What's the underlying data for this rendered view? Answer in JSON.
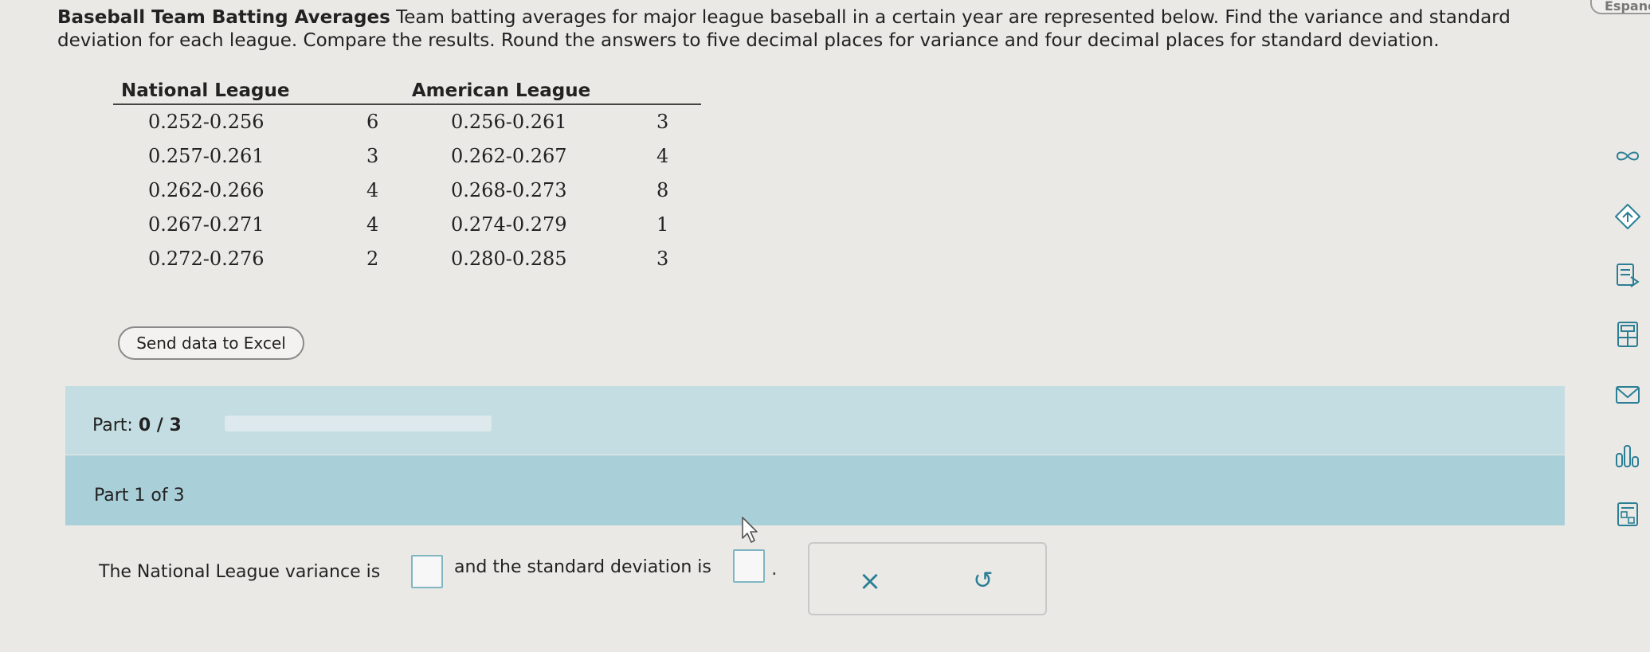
{
  "problem": {
    "title": "Baseball Team Batting Averages",
    "text": " Team batting averages for major league baseball in a certain year are represented below. Find the variance and standard deviation for each league. Compare the results. Round the answers to five decimal places for variance and four decimal places for standard deviation."
  },
  "table": {
    "headers": [
      "National League",
      "",
      "American League",
      ""
    ],
    "rows": [
      [
        "0.252-0.256",
        "6",
        "0.256-0.261",
        "3"
      ],
      [
        "0.257-0.261",
        "3",
        "0.262-0.267",
        "4"
      ],
      [
        "0.262-0.266",
        "4",
        "0.268-0.273",
        "8"
      ],
      [
        "0.267-0.271",
        "4",
        "0.274-0.279",
        "1"
      ],
      [
        "0.272-0.276",
        "2",
        "0.280-0.285",
        "3"
      ]
    ]
  },
  "excel_button": "Send data to Excel",
  "part": {
    "label": "Part:",
    "value": "0 / 3",
    "progress": 0
  },
  "subpart": {
    "label": "Part 1 of 3"
  },
  "question": {
    "before": "The National League variance is",
    "middle": "and the standard deviation is",
    "end": "."
  },
  "actions": {
    "clear_glyph": "×",
    "undo_glyph": "↺"
  },
  "sidebar": {
    "language": "Espanol",
    "icons": [
      "infinity-icon",
      "hint-icon",
      "ebook-icon",
      "calculator-icon",
      "mail-icon",
      "statistics-icon",
      "formula-icon"
    ]
  },
  "colors": {
    "accent": "#2b7f95",
    "part_bar": "#c4dde2",
    "subpart_bar": "#a9cfd8"
  }
}
